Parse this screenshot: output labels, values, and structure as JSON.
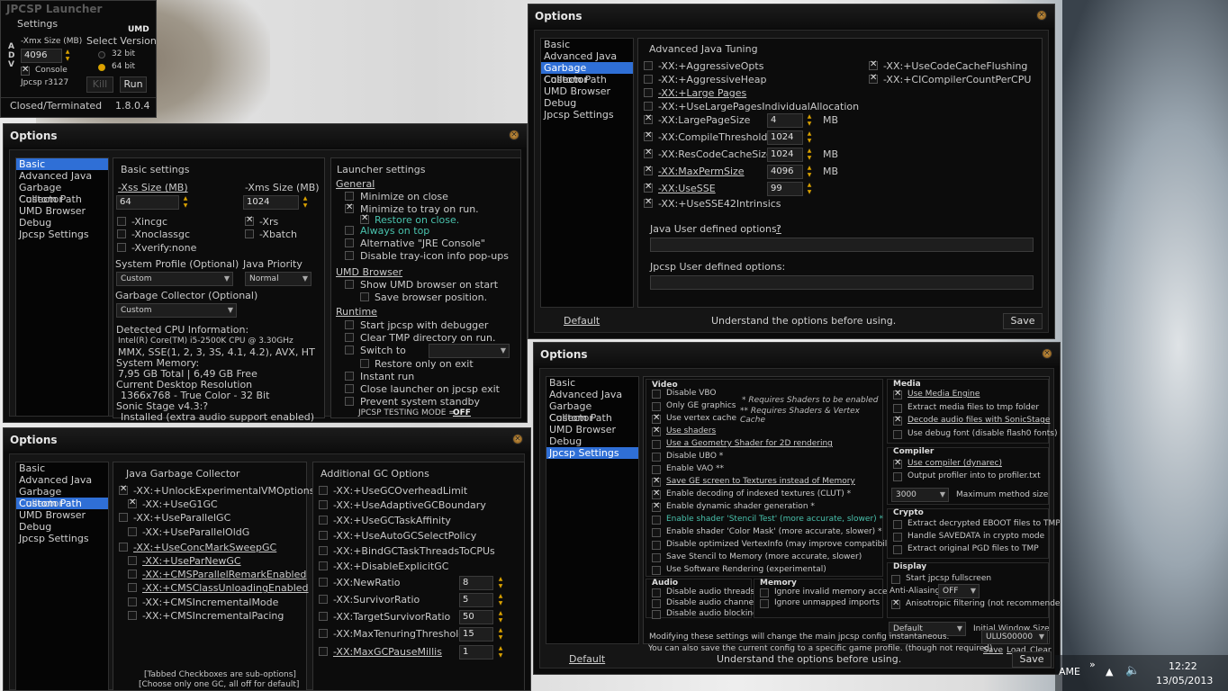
{
  "launcher": {
    "title": "JPCSP Launcher",
    "settings": "Settings",
    "umd": "UMD",
    "xmx_label": "-Xmx Size (MB)",
    "select_version": "Select Version",
    "xmx_value": "4096",
    "adv": "A D V",
    "v32": "32 bit",
    "v64": "64 bit",
    "console": "Console",
    "build": "Jpcsp r3127",
    "kill": "Kill",
    "run": "Run",
    "status": "Closed/Terminated",
    "version": "1.8.0.4"
  },
  "nav": [
    "Basic",
    "Advanced Java",
    "Garbage Collector",
    "Custom Path",
    "UMD Browser",
    "Debug",
    "Jpcsp Settings"
  ],
  "common": {
    "options": "Options",
    "default": "Default",
    "understand": "Understand the options before using.",
    "save": "Save"
  },
  "basic": {
    "basic_settings": "Basic settings",
    "xss_label": "-Xss Size (MB)",
    "xms_label": "-Xms Size (MB)",
    "xss_value": "64",
    "xms_value": "1024",
    "xincgc": "-Xincgc",
    "xrs": "-Xrs",
    "xnoclassgc": "-Xnoclassgc",
    "xbatch": "-Xbatch",
    "xverify": "-Xverify:none",
    "sys_profile": "System Profile (Optional)",
    "java_priority": "Java Priority",
    "profile_value": "Custom",
    "priority_value": "Normal",
    "gc_optional": "Garbage Collector (Optional)",
    "gc_value": "Custom",
    "cpu_title": "Detected CPU Information:",
    "cpu_name": "Intel(R) Core(TM) i5-2500K CPU @ 3.30GHz",
    "cpu_flags": "MMX, SSE(1, 2, 3, 3S, 4.1, 4.2), AVX, HT",
    "mem_title": "System Memory:",
    "mem_value": "7,95 GB Total | 6,49 GB Free",
    "res_title": "Current Desktop Resolution",
    "res_value": "1366x768 - True Color - 32 Bit",
    "sonic_title": "Sonic Stage v4.3:?",
    "sonic_value": "Installed (extra audio support enabled)",
    "launcher_settings": "Launcher settings",
    "general": "General",
    "minimize_close": "Minimize on close",
    "minimize_tray": "Minimize to tray on run.",
    "restore_close": "Restore on close.",
    "always_top": "Always on top",
    "alt_jre": "Alternative \"JRE Console\"",
    "disable_tray": "Disable tray-icon info pop-ups",
    "umd_browser": "UMD Browser",
    "show_umd": "Show UMD browser on start",
    "save_browser": "Save browser position.",
    "runtime": "Runtime",
    "start_debugger": "Start jpcsp with debugger",
    "clear_tmp": "Clear TMP directory on run.",
    "switch_to": "Switch to",
    "restore_exit": "Restore only on exit",
    "instant_run": "Instant run",
    "close_launcher": "Close launcher on jpcsp exit",
    "prevent_standby": "Prevent system standby",
    "testing_mode": "JPCSP TESTING MODE =",
    "testing_value": "OFF"
  },
  "advjava": {
    "title": "Advanced Java Tuning",
    "opts": [
      "-XX:+AggressiveOpts",
      "-XX:+AggressiveHeap",
      "-XX:+Large Pages",
      "-XX:+UseLargePagesIndividualAllocation",
      "-XX:LargePageSize",
      "-XX:CompileThreshold",
      "-XX:ResCodeCacheSize",
      "-XX:MaxPermSize",
      "-XX:UseSSE",
      "-XX:+UseSSE42Intrinsics"
    ],
    "vals": [
      "4",
      "1024",
      "1024",
      "4096",
      "99"
    ],
    "units": [
      "MB",
      "MB",
      "MB"
    ],
    "right": [
      "-XX:+UseCodeCacheFlushing",
      "-XX:+CICompilerCountPerCPU"
    ],
    "java_user": "Java User defined options:",
    "java_user_q": "?",
    "jpcsp_user": "Jpcsp User defined options:"
  },
  "gc": {
    "title": "Java Garbage Collector",
    "left": [
      "-XX:+UnlockExperimentalVMOptions",
      "-XX:+UseG1GC",
      "-XX:+UseParallelGC",
      "-XX:+UseParallelOldG",
      "-XX:+UseConcMarkSweepGC",
      "-XX:+UseParNewGC",
      "-XX:+CMSParallelRemarkEnabled",
      "-XX:+CMSClassUnloadingEnabled",
      "-XX:+CMSIncrementalMode",
      "-XX:+CMSIncrementalPacing"
    ],
    "add_title": "Additional GC Options",
    "right": [
      "-XX:+UseGCOverheadLimit",
      "-XX:+UseAdaptiveGCBoundary",
      "-XX:+UseGCTaskAffinity",
      "-XX:+UseAutoGCSelectPolicy",
      "-XX:+BindGCTaskThreadsToCPUs",
      "-XX:+DisableExplicitGC",
      "-XX:NewRatio",
      "-XX:SurvivorRatio",
      "-XX:TargetSurvivorRatio",
      "-XX:MaxTenuringThreshold",
      "-XX:MaxGCPauseMillis"
    ],
    "vals": [
      "8",
      "5",
      "50",
      "15",
      "1"
    ],
    "note1": "[Tabbed Checkboxes are sub-options]",
    "note2": "[Choose only one GC, all off for default]"
  },
  "jset": {
    "video": "Video",
    "video_items": [
      "Disable VBO",
      "Only GE graphics",
      "Use vertex cache",
      "Use shaders",
      "Use a Geometry Shader for 2D rendering",
      "Disable UBO *",
      "Enable VAO **",
      "Save GE screen to Textures instead of Memory",
      "Enable decoding of indexed textures (CLUT) *",
      "Enable dynamic shader generation *",
      "Enable shader 'Stencil Test'  (more accurate, slower) *",
      "Enable shader 'Color Mask' (more accurate,  slower) *",
      "Disable optimized VertexInfo (may improve compatibility)",
      "Save Stencil to Memory  (more accurate,  slower)",
      "Use Software Rendering (experimental)"
    ],
    "hint1": "* Requires Shaders to be enabled",
    "hint2": "** Requires Shaders & Vertex Cache",
    "audio": "Audio",
    "audio_items": [
      "Disable audio threads",
      "Disable audio channels",
      "Disable audio blocking"
    ],
    "memory": "Memory",
    "memory_items": [
      "Ignore invalid memory access",
      "Ignore unmapped imports"
    ],
    "media": "Media",
    "media_items": [
      "Use Media Engine",
      "Extract media files to tmp folder",
      "Decode audio files with SonicStage",
      "Use debug font (disable flash0 fonts)"
    ],
    "compiler": "Compiler",
    "compiler_items": [
      "Use compiler (dynarec)",
      "Output profiler into to profiler.txt"
    ],
    "method_value": "3000",
    "method_label": "Maximum method size",
    "crypto": "Crypto",
    "crypto_items": [
      "Extract decrypted EBOOT files to TMP",
      "Handle SAVEDATA in crypto mode",
      "Extract original PGD files to TMP"
    ],
    "display": "Display",
    "fullscreen": "Start jpcsp fullscreen",
    "anti": "Anti-Aliasing",
    "anti_value": "OFF",
    "aniso": "Anisotropic filtering (not recommended)",
    "win_value": "Default",
    "win_label": "Initial Window Size",
    "modify1": "Modifying these settings will change the main jpcsp config instantaneous.",
    "modify2": "You can also save the current config to a specific game profile. (though not required)",
    "game_id": "ULUS00000",
    "save_link": "Save",
    "load_link": "Load",
    "clear_link": "Clear"
  },
  "taskbar": {
    "ame": "AME",
    "time": "12:22",
    "date": "13/05/2013"
  }
}
